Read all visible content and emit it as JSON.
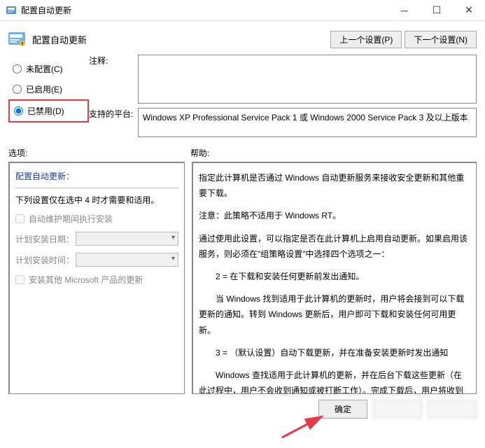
{
  "window": {
    "title": "配置自动更新"
  },
  "header": {
    "title": "配置自动更新",
    "prev_button": "上一个设置(P)",
    "next_button": "下一个设置(N)"
  },
  "radios": {
    "not_configured": "未配置(C)",
    "enabled": "已启用(E)",
    "disabled": "已禁用(D)"
  },
  "labels": {
    "notes": "注释:",
    "platform": "支持的平台:",
    "options": "选项:",
    "help": "帮助:"
  },
  "platform_text": "Windows XP Professional Service Pack 1 或 Windows 2000 Service Pack 3 及以上版本",
  "options_panel": {
    "title": "配置自动更新：",
    "note": "下列设置仅在选中 4 时才需要和适用。",
    "chk_maint": "自动维护期间执行安装",
    "plan_day": "计划安装日期：",
    "plan_time": "计划安装时间：",
    "chk_other": "安装其他 Microsoft 产品的更新"
  },
  "help_panel": {
    "p1": "指定此计算机是否通过 Windows 自动更新服务来接收安全更新和其他重要下载。",
    "p2": "注意：此策略不适用于 Windows RT。",
    "p3": "通过使用此设置，可以指定是否在此计算机上启用自动更新。如果启用该服务，则必须在\"组策略设置\"中选择四个选项之一：",
    "p4": "2 = 在下载和安装任何更新前发出通知。",
    "p5": "当 Windows 找到适用于此计算机的更新时，用户将会接到可以下载更新的通知。转到 Windows 更新后，用户即可下载和安装任何可用更新。",
    "p6": "3 = （默认设置）自动下载更新，并在准备安装更新时发出通知",
    "p7": "Windows 查找适用于此计算机的更新，并在后台下载这些更新（在此过程中，用户不会收到通知或被打断工作）。完成下载后，用户将收到可以安装更新的通知。转到 Windows 更新后，"
  },
  "footer": {
    "ok": "确定"
  }
}
